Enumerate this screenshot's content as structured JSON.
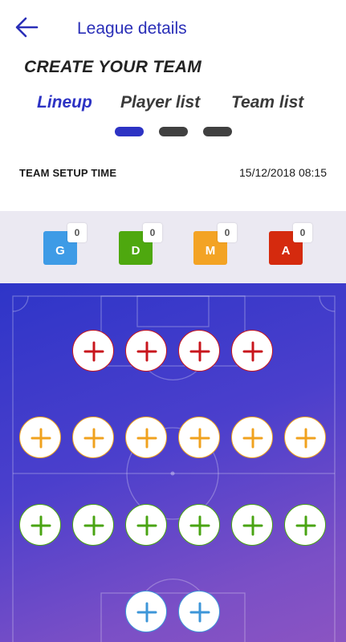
{
  "header": {
    "title": "League details",
    "back_icon": "arrow-left-icon"
  },
  "create_title": "CREATE YOUR TEAM",
  "tabs": [
    {
      "label": "Lineup",
      "active": true
    },
    {
      "label": "Player list",
      "active": false
    },
    {
      "label": "Team list",
      "active": false
    }
  ],
  "setup": {
    "label": "TEAM SETUP TIME",
    "value": "15/12/2018 08:15"
  },
  "positions": [
    {
      "letter": "G",
      "count": "0",
      "color": "#3e9be6"
    },
    {
      "letter": "D",
      "count": "0",
      "color": "#4ea80f"
    },
    {
      "letter": "M",
      "count": "0",
      "color": "#f3a324"
    },
    {
      "letter": "A",
      "count": "0",
      "color": "#d52a0e"
    }
  ],
  "pitch": {
    "colors": {
      "attack": "#c8161d",
      "midfield": "#f0a21e",
      "defense": "#4aa413",
      "goalkeeper": "#3d96d8"
    },
    "slot_icon": "plus-icon"
  }
}
